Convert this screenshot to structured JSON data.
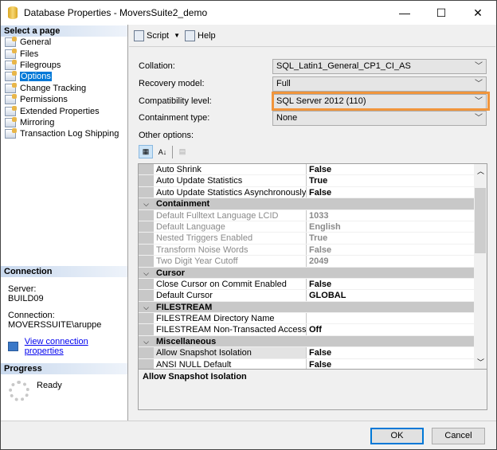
{
  "window": {
    "title": "Database Properties - MoversSuite2_demo",
    "minimize": "—",
    "maximize": "☐",
    "close": "✕"
  },
  "sidebar": {
    "header": "Select a page",
    "items": [
      {
        "label": "General"
      },
      {
        "label": "Files"
      },
      {
        "label": "Filegroups"
      },
      {
        "label": "Options",
        "selected": true
      },
      {
        "label": "Change Tracking"
      },
      {
        "label": "Permissions"
      },
      {
        "label": "Extended Properties"
      },
      {
        "label": "Mirroring"
      },
      {
        "label": "Transaction Log Shipping"
      }
    ]
  },
  "connection": {
    "header": "Connection",
    "server_label": "Server:",
    "server": "BUILD09",
    "connection_label": "Connection:",
    "connection": "MOVERSSUITE\\aruppe",
    "link": "View connection properties"
  },
  "progress": {
    "header": "Progress",
    "status": "Ready"
  },
  "toolbar": {
    "script": "Script",
    "help": "Help"
  },
  "options": {
    "collation": {
      "label": "Collation:",
      "value": "SQL_Latin1_General_CP1_CI_AS"
    },
    "recovery": {
      "label": "Recovery model:",
      "value": "Full"
    },
    "compat": {
      "label": "Compatibility level:",
      "value": "SQL Server 2012 (110)"
    },
    "containment": {
      "label": "Containment type:",
      "value": "None"
    },
    "other_label": "Other options:"
  },
  "highlight_color": "#f0953c",
  "grid": {
    "rows": [
      {
        "name": "Auto Shrink",
        "value": "False"
      },
      {
        "name": "Auto Update Statistics",
        "value": "True"
      },
      {
        "name": "Auto Update Statistics Asynchronously",
        "value": "False"
      },
      {
        "name": "Containment",
        "category": true
      },
      {
        "name": "Default Fulltext Language LCID",
        "value": "1033",
        "disabled": true
      },
      {
        "name": "Default Language",
        "value": "English",
        "disabled": true
      },
      {
        "name": "Nested Triggers Enabled",
        "value": "True",
        "disabled": true
      },
      {
        "name": "Transform Noise Words",
        "value": "False",
        "disabled": true
      },
      {
        "name": "Two Digit Year Cutoff",
        "value": "2049",
        "disabled": true
      },
      {
        "name": "Cursor",
        "category": true
      },
      {
        "name": "Close Cursor on Commit Enabled",
        "value": "False"
      },
      {
        "name": "Default Cursor",
        "value": "GLOBAL"
      },
      {
        "name": "FILESTREAM",
        "category": true
      },
      {
        "name": "FILESTREAM Directory Name",
        "value": ""
      },
      {
        "name": "FILESTREAM Non-Transacted Access",
        "value": "Off"
      },
      {
        "name": "Miscellaneous",
        "category": true
      },
      {
        "name": "Allow Snapshot Isolation",
        "value": "False",
        "selected": true
      },
      {
        "name": "ANSI NULL Default",
        "value": "False"
      }
    ]
  },
  "description": "Allow Snapshot Isolation",
  "buttons": {
    "ok": "OK",
    "cancel": "Cancel"
  }
}
